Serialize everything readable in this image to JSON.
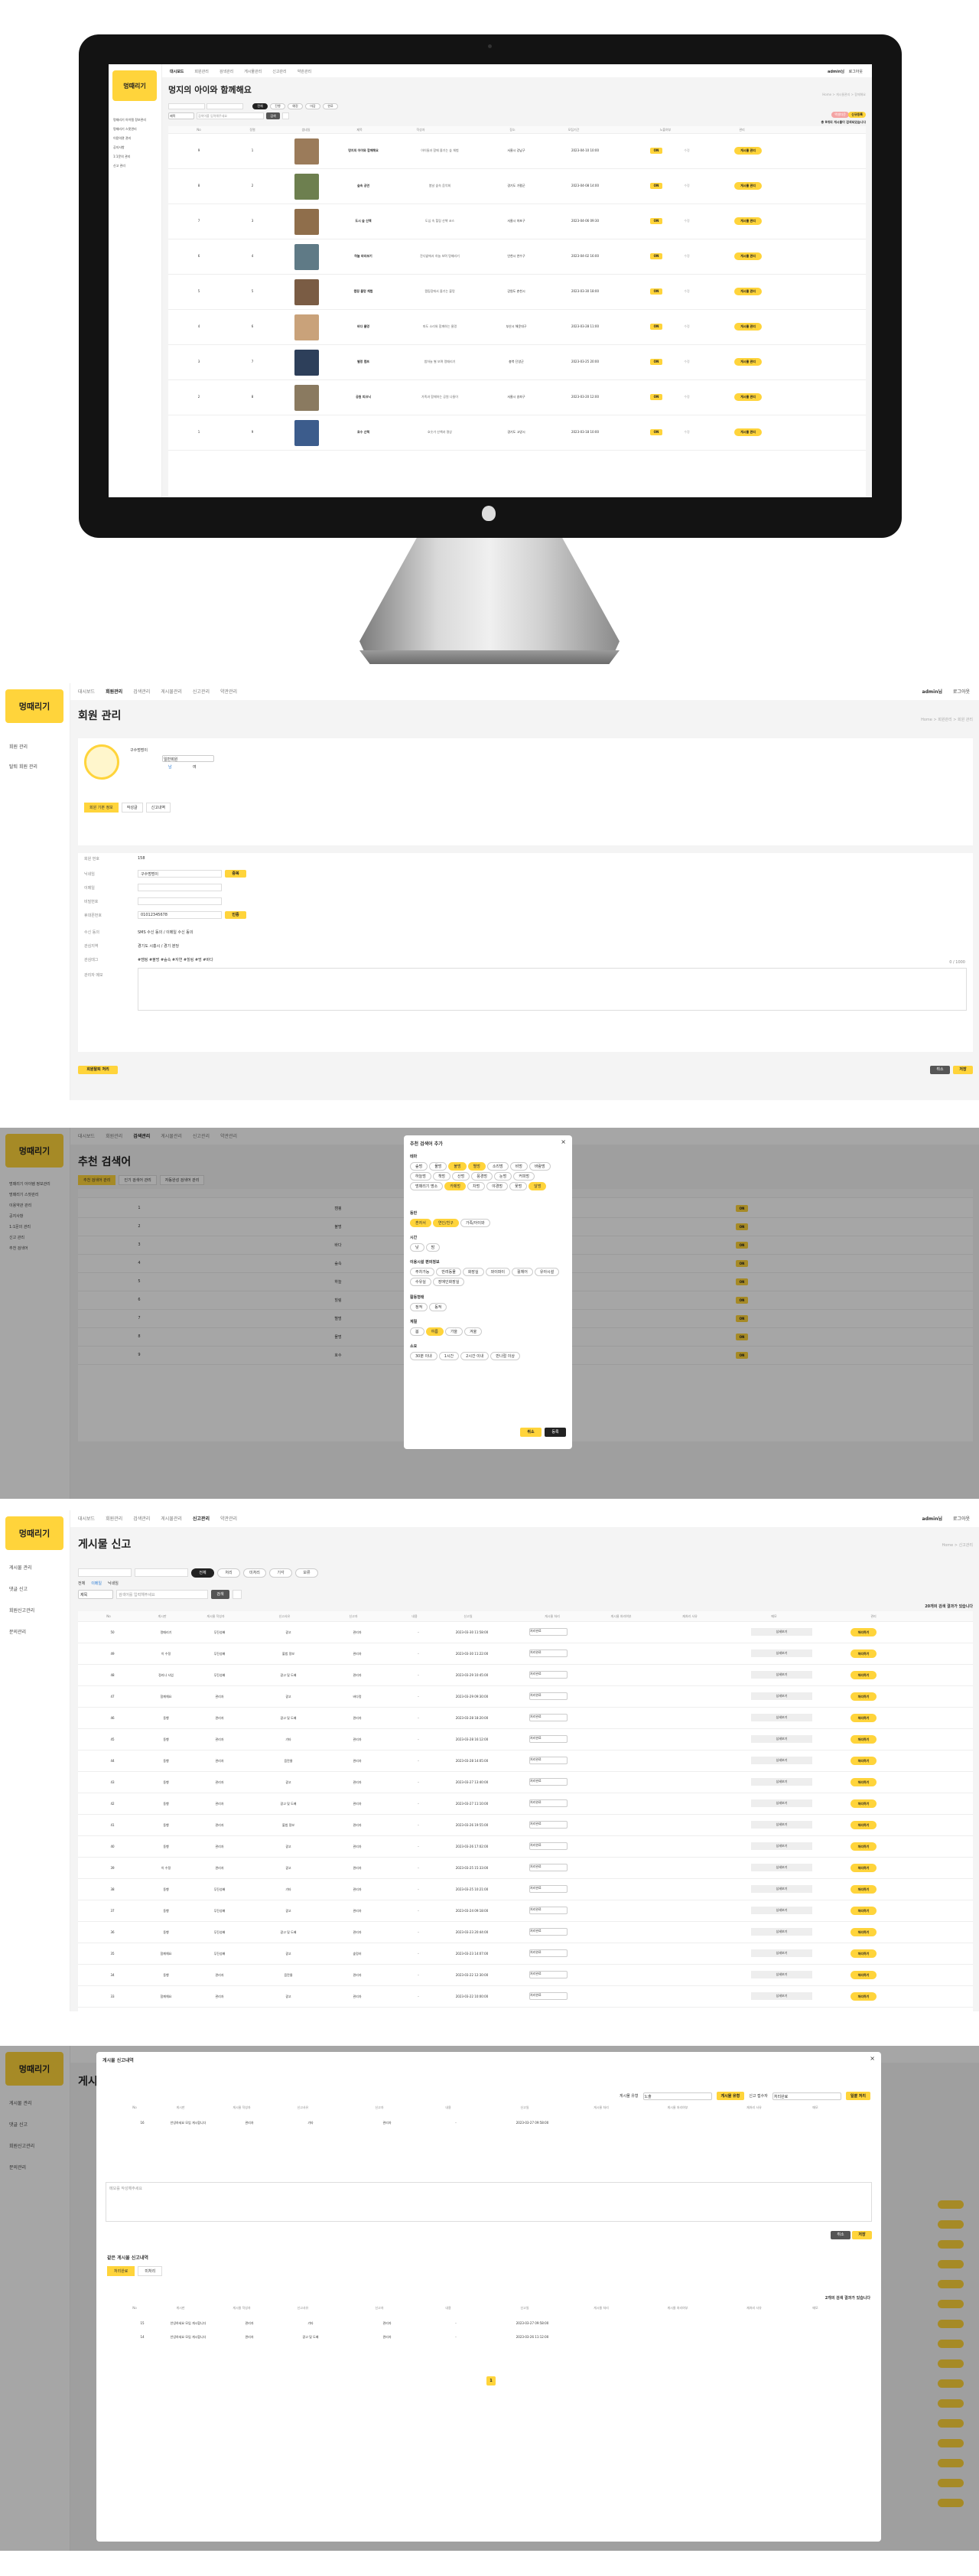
{
  "brand": "멍때리기",
  "s1": {
    "nav": [
      "대시보드",
      "회원관리",
      "검색관리",
      "게시물관리",
      "신고관리",
      "약관관리"
    ],
    "user": "admin님",
    "logout": "로그아웃",
    "side": [
      "멍때리기 아이템 정보관리",
      "멍때리기 스팟관리",
      "이용약관 관리",
      "공지사항",
      "1:1문의 관리",
      "신고 관리"
    ],
    "title": "멍지의 아이와 함께해요",
    "crumb": "Home > 게시물관리 > 함께해요",
    "filters": [
      "전체",
      "진행",
      "예정",
      "마감",
      "완료"
    ],
    "search_select": "제목",
    "search_ph": "검색어를 입력해주세요",
    "search_btn": "검색",
    "excel": "엑셀다운",
    "add": "신규등록",
    "count": "총 9개의 게시물이 검색되었습니다",
    "cols": [
      "No",
      "정렬",
      "썸네일",
      "제목",
      "작성자",
      "장소",
      "모집기간",
      "노출여부",
      "관리"
    ],
    "rows": [
      {
        "no": "9",
        "ord": "1",
        "title": "멍지의 아이와 함께해요",
        "desc": "아이들과 함께 즐기는 숲 체험",
        "loc": "서울시 강남구",
        "date": "2023-04-10 10:00",
        "th": "#9b7b5a"
      },
      {
        "no": "8",
        "ord": "2",
        "title": "숲속 공연",
        "desc": "봄날 숲속 음악회",
        "loc": "경기도 가평군",
        "date": "2023-04-08 14:00",
        "th": "#6d7f4f"
      },
      {
        "no": "7",
        "ord": "3",
        "title": "도시 숲 산책",
        "desc": "도심 속 힐링 산책 코스",
        "loc": "서울시 마포구",
        "date": "2023-04-06 09:30",
        "th": "#8f6e4b"
      },
      {
        "no": "6",
        "ord": "4",
        "title": "하늘 바라보기",
        "desc": "잔디밭에서 하늘 보며 멍때리기",
        "loc": "인천시 연수구",
        "date": "2023-04-02 16:00",
        "th": "#5f7a86"
      },
      {
        "no": "5",
        "ord": "5",
        "title": "캠핑 불멍 체험",
        "desc": "캠핑장에서 즐기는 불멍",
        "loc": "강원도 춘천시",
        "date": "2023-03-30 18:00",
        "th": "#7a5c44"
      },
      {
        "no": "4",
        "ord": "6",
        "title": "바다 물멍",
        "desc": "파도 소리와 함께하는 물멍",
        "loc": "부산시 해운대구",
        "date": "2023-03-28 11:00",
        "th": "#c9a27a"
      },
      {
        "no": "3",
        "ord": "7",
        "title": "별멍 캠프",
        "desc": "밤하늘 별 보며 멍때리기",
        "loc": "충북 단양군",
        "date": "2023-03-25 20:00",
        "th": "#2d3f5a"
      },
      {
        "no": "2",
        "ord": "8",
        "title": "공원 피크닉",
        "desc": "가족과 함께하는 공원 나들이",
        "loc": "서울시 송파구",
        "date": "2023-03-20 12:00",
        "th": "#8a7a60"
      },
      {
        "no": "1",
        "ord": "9",
        "title": "호수 산책",
        "desc": "호숫가 산책과 명상",
        "loc": "경기도 고양시",
        "date": "2023-03-18 10:00",
        "th": "#3c5c8c"
      }
    ],
    "show": "ON",
    "edit": "수정",
    "manage": "게시물 관리"
  },
  "s2": {
    "nav": [
      "대시보드",
      "회원관리",
      "검색관리",
      "게시물관리",
      "신고관리",
      "약관관리"
    ],
    "user": "admin님",
    "logout": "로그아웃",
    "side": [
      "회원 관리",
      "탈퇴 회원 관리"
    ],
    "title": "회원 관리",
    "crumb": "Home > 회원관리 > 회원 관리",
    "profile_name": "구수멍멍이",
    "profile_type": "일반회원",
    "gender_m": "남",
    "gender_f": "여",
    "tabs": [
      "회원 기본 정보",
      "작성글",
      "신고내역"
    ],
    "fields": [
      {
        "k": "회원 번호",
        "v": "158"
      },
      {
        "k": "닉네임",
        "v": "구수멍멍이",
        "btn": "중복"
      },
      {
        "k": "이메일",
        "v": ""
      },
      {
        "k": "비밀번호",
        "v": ""
      },
      {
        "k": "휴대폰번호",
        "v": "01012345678",
        "btn": "인증"
      },
      {
        "k": "수신 동의",
        "v": "SMS 수신 동의 / 이메일 수신 동의"
      },
      {
        "k": "관심지역",
        "v": "경기도 시흥시 / 경기 분당"
      },
      {
        "k": "관심태그",
        "v": "#캠핑 #불멍 #숲속 #자연 #힐링 #멍 #바다"
      },
      {
        "k": "관리자 메모",
        "v": "메모"
      }
    ],
    "memo_count": "0 / 1000",
    "withdraw": "회원탈퇴 처리",
    "cancel": "취소",
    "save": "저장"
  },
  "s3": {
    "side": [
      "멍때리기 아이템 정보관리",
      "멍때리기 스팟관리",
      "이용약관 관리",
      "공지사항",
      "1:1문의 관리",
      "신고 관리",
      "추천 검색어"
    ],
    "title": "추천 검색어",
    "tabs": [
      "추천 검색어 관리",
      "인기 검색어 관리",
      "자동완성 검색어 관리"
    ],
    "modal": {
      "title": "추천 검색어 추가",
      "groups": [
        {
          "label": "테마",
          "tags": [
            "숲멍",
            "물멍",
            "불멍",
            "별멍",
            "소리멍",
            "비멍",
            "바람멍",
            "하늘멍",
            "책멍",
            "산멍",
            "풍경멍",
            "눈멍",
            "커피멍",
            "멍때리기 명소",
            "카페멍",
            "차멍",
            "야경멍",
            "꽃멍",
            "달멍"
          ],
          "on": [
            2,
            3,
            14,
            18
          ]
        },
        {
          "label": "동반",
          "tags": [
            "혼자서",
            "연인/친구",
            "가족/아이와"
          ],
          "on": [
            0,
            1
          ]
        },
        {
          "label": "시간",
          "tags": [
            "낮",
            "밤"
          ],
          "on": []
        },
        {
          "label": "이용시설 편의정보",
          "tags": [
            "주차가능",
            "반려동물",
            "화장실",
            "와이파이",
            "휠체어",
            "유아시설",
            "수유실",
            "장애인화장실"
          ],
          "on": []
        },
        {
          "label": "활동형태",
          "tags": [
            "정적",
            "동적"
          ],
          "on": []
        },
        {
          "label": "계절",
          "tags": [
            "봄",
            "여름",
            "가을",
            "겨울"
          ],
          "on": [
            1
          ]
        },
        {
          "label": "소요",
          "tags": [
            "30분 이내",
            "1시간",
            "2시간 이내",
            "반나절 이상"
          ],
          "on": []
        }
      ],
      "cancel": "취소",
      "ok": "등록"
    },
    "rows": [
      "1",
      "2",
      "3",
      "4",
      "5",
      "6",
      "7",
      "8",
      "9"
    ],
    "words": [
      "캠핑",
      "불멍",
      "바다",
      "숲속",
      "하늘",
      "힐링",
      "별멍",
      "물멍",
      "호수"
    ]
  },
  "s4": {
    "nav": [
      "대시보드",
      "회원관리",
      "검색관리",
      "게시물관리",
      "신고관리",
      "약관관리"
    ],
    "user": "admin님",
    "logout": "로그아웃",
    "side": [
      "게시물 관리",
      "댓글 신고",
      "회원신고관리",
      "문의관리"
    ],
    "title": "게시물 신고",
    "crumb": "Home > 신고관리",
    "filters": [
      "전체",
      "처리",
      "미처리",
      "기각",
      "보류"
    ],
    "radio": [
      "전체",
      "이메일",
      "닉네임"
    ],
    "search_select": "제목",
    "search_ph": "검색어를 입력해주세요",
    "search_btn": "검색",
    "count": "20개의 검색 결과가 있습니다",
    "cols": [
      "No",
      "게시판",
      "게시물 작성자",
      "신고사유",
      "신고자",
      "내용",
      "신고일",
      "게시물 처리",
      "게시물 처리여부",
      "재처리 사유",
      "메모",
      "관리"
    ],
    "rows": [
      [
        "50",
        "멍때리기",
        "무진성배",
        "광고",
        "관리자",
        "-",
        "2023-03-30 11:58:00",
        "노출"
      ],
      [
        "49",
        "이 수정",
        "무진성배",
        "불법 정보",
        "관리자",
        "-",
        "2023-03-30 11:22:00",
        "노출"
      ],
      [
        "48",
        "정리나 사업",
        "무진성배",
        "광고 및 도배",
        "관리자",
        "-",
        "2023-03-29 10:45:00",
        "노출"
      ],
      [
        "47",
        "함께해요",
        "관리자",
        "광고",
        "바다멍",
        "-",
        "2023-03-29 09:30:00",
        "게시물 차단"
      ],
      [
        "46",
        "동행",
        "관리자",
        "광고 및 도배",
        "관리자",
        "-",
        "2023-03-28 18:20:00",
        "노출"
      ],
      [
        "45",
        "동행",
        "관리자",
        "기타",
        "관리자",
        "-",
        "2023-03-28 16:12:00",
        "노출"
      ],
      [
        "44",
        "동행",
        "관리자",
        "음란물",
        "관리자",
        "-",
        "2023-03-28 14:05:00",
        "게시물 차단"
      ],
      [
        "43",
        "동행",
        "관리자",
        "광고",
        "관리자",
        "-",
        "2023-03-27 13:40:00",
        "노출"
      ],
      [
        "42",
        "동행",
        "관리자",
        "광고 및 도배",
        "관리자",
        "-",
        "2023-03-27 11:10:00",
        "노출"
      ],
      [
        "41",
        "동행",
        "관리자",
        "불법 정보",
        "관리자",
        "-",
        "2023-03-26 19:55:00",
        "게시물 차단"
      ],
      [
        "40",
        "동행",
        "관리자",
        "광고",
        "관리자",
        "-",
        "2023-03-26 17:02:00",
        "노출"
      ],
      [
        "39",
        "이 수정",
        "관리자",
        "광고",
        "관리자",
        "-",
        "2023-03-25 15:33:00",
        "게시물 차단"
      ],
      [
        "38",
        "동행",
        "무진성배",
        "기타",
        "관리자",
        "-",
        "2023-03-25 10:21:00",
        "노출"
      ],
      [
        "37",
        "동행",
        "무진성배",
        "광고",
        "관리자",
        "-",
        "2023-03-24 09:18:00",
        "게시물 차단"
      ],
      [
        "36",
        "동행",
        "무진성배",
        "광고 및 도배",
        "관리자",
        "-",
        "2023-03-23 20:44:00",
        "노출"
      ],
      [
        "35",
        "함께해요",
        "무진성배",
        "광고",
        "숲멍러",
        "-",
        "2023-03-23 14:07:00",
        "노출"
      ],
      [
        "34",
        "동행",
        "관리자",
        "음란물",
        "관리자",
        "-",
        "2023-03-22 12:30:00",
        "노출"
      ],
      [
        "33",
        "함께해요",
        "관리자",
        "광고",
        "관리자",
        "-",
        "2023-03-22 10:00:00",
        "노출"
      ]
    ],
    "proc": "처리하기",
    "detail": "상세보기"
  },
  "s5": {
    "modal_title": "게시물 신고내역",
    "filter_label": "게시물 유형",
    "filter_val": "노출",
    "status_label": "신고 접수자",
    "status_val": "처리완료",
    "btn1": "게시물 유형",
    "btn2": "일괄 처리",
    "top_row": [
      "16",
      "안녕하세요 모임 게시합니다",
      "관리자",
      "기타",
      "관리자",
      "-",
      "2023-03-27 09:58:00"
    ],
    "memo_ph": "메모를 작성해주세요",
    "cancel": "취소",
    "save": "저장",
    "sub_title": "같은 게시물 신고내역",
    "tabs": [
      "처리완료",
      "미처리"
    ],
    "count": "2개의 검색 결과가 있습니다",
    "rows": [
      [
        "15",
        "안녕하세요 모임 게시합니다",
        "관리자",
        "기타",
        "관리자",
        "-",
        "2023-03-27 09:58:00"
      ],
      [
        "14",
        "안녕하세요 모임 게시합니다",
        "관리자",
        "광고 및 도배",
        "관리자",
        "-",
        "2023-03-26 11:12:00"
      ]
    ],
    "page": "1",
    "side": [
      "게시물 관리",
      "댓글 신고",
      "회원신고관리",
      "문의관리"
    ],
    "title": "게시물 신고"
  }
}
